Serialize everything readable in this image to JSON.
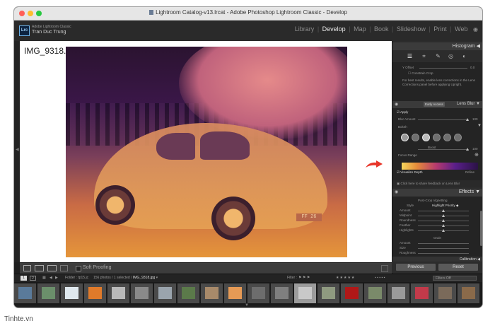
{
  "window": {
    "title": "Lightroom Catalog-v13.lrcat - Adobe Photoshop Lightroom Classic - Develop"
  },
  "identity": {
    "product": "Adobe Lightroom Classic",
    "user": "Tran Duc Trung",
    "logo": "Lrc"
  },
  "modules": [
    {
      "label": "Library",
      "active": false
    },
    {
      "label": "Develop",
      "active": true
    },
    {
      "label": "Map",
      "active": false
    },
    {
      "label": "Book",
      "active": false
    },
    {
      "label": "Slideshow",
      "active": false
    },
    {
      "label": "Print",
      "active": false
    },
    {
      "label": "Web",
      "active": false
    }
  ],
  "photo": {
    "filename": "IMG_9318.jpg",
    "plate": "FF 26"
  },
  "toolbar": {
    "soft_proofing_label": "Soft Proofing"
  },
  "right_panel": {
    "histogram_label": "Histogram",
    "lens_corrections": {
      "offset_label": "Y Offset",
      "offset_value": "0.0",
      "constrain_crop": "Constrain Crop",
      "hint": "For best results, enable lens corrections in the Lens Corrections panel before applying Upright."
    },
    "lens_blur": {
      "badge": "Early Access",
      "title": "Lens Blur",
      "apply_label": "Apply",
      "blur_amount_label": "Blur Amount",
      "blur_amount_value": "100",
      "bokeh_label": "Bokeh",
      "boost_label": "Boost",
      "boost_value": "100",
      "focus_range_label": "Focus Range",
      "visualize_depth_label": "Visualize Depth",
      "refine_label": "Refine",
      "feedback_label": "Click here to share feedback on Lens Blur"
    },
    "effects": {
      "title": "Effects",
      "post_crop_label": "Post-Crop Vignetting",
      "style_label": "Style",
      "style_value": "Highlight Priority",
      "rows": [
        "Amount",
        "Midpoint",
        "Roundness",
        "Feather",
        "Highlights"
      ],
      "grain_label": "Grain",
      "grain_rows": [
        "Amount",
        "Size",
        "Roughness"
      ],
      "calibration_label": "Calibration"
    },
    "buttons": {
      "previous": "Previous",
      "reset": "Reset"
    }
  },
  "filmstrip_bar": {
    "folder_label": "Folder : tp15.jc",
    "count_label": "156 photos / 1 selected /",
    "selected_file": "IMG_9318.jpg",
    "filter_label": "Filter :",
    "filter_value": "Filters Off",
    "page_1": "1",
    "page_2": "2"
  },
  "watermark": "Tinhte.vn",
  "colors": {
    "accent_arrow": "#e8362a"
  }
}
